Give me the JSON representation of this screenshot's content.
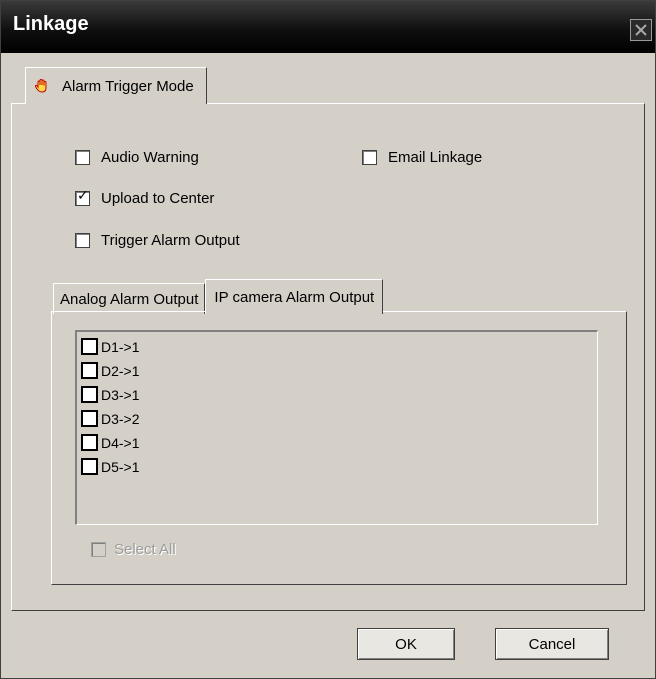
{
  "dialog": {
    "title": "Linkage"
  },
  "outer_tab": {
    "label": "Alarm Trigger Mode",
    "icon": "hand-icon"
  },
  "options": {
    "audio_warning": {
      "label": "Audio Warning",
      "checked": false
    },
    "email_linkage": {
      "label": "Email Linkage",
      "checked": false
    },
    "upload_center": {
      "label": "Upload to Center",
      "checked": true
    },
    "trigger_output": {
      "label": "Trigger Alarm Output",
      "checked": false
    }
  },
  "inner_tabs": [
    {
      "label": "Analog Alarm Output",
      "active": false
    },
    {
      "label": "IP camera Alarm Output",
      "active": true
    }
  ],
  "outputs": [
    {
      "label": "D1->1",
      "checked": false
    },
    {
      "label": "D2->1",
      "checked": false
    },
    {
      "label": "D3->1",
      "checked": false
    },
    {
      "label": "D3->2",
      "checked": false
    },
    {
      "label": "D4->1",
      "checked": false
    },
    {
      "label": "D5->1",
      "checked": false
    }
  ],
  "select_all": {
    "label": "Select All",
    "enabled": false
  },
  "buttons": {
    "ok": "OK",
    "cancel": "Cancel"
  }
}
